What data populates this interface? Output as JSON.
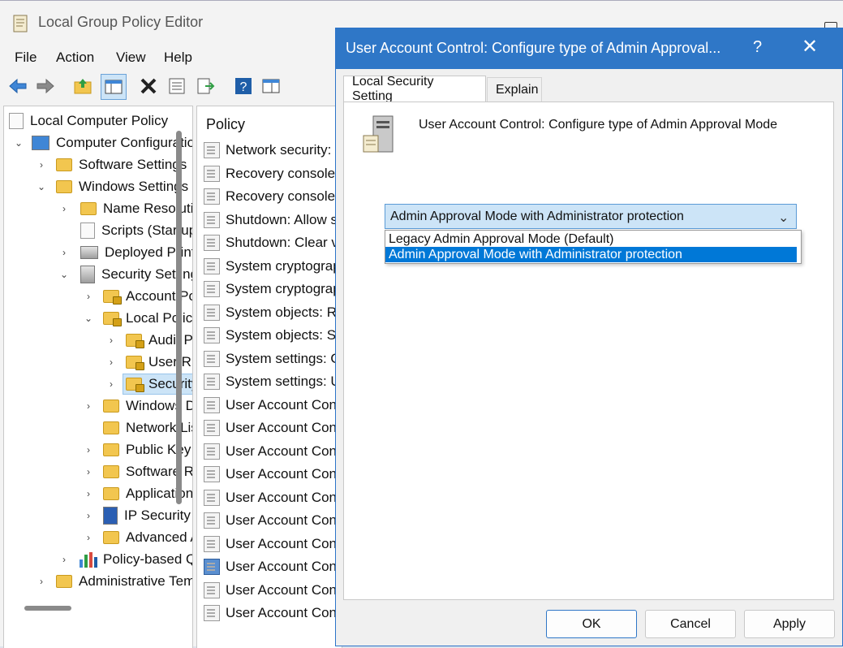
{
  "app": {
    "title": "Local Group Policy Editor"
  },
  "menu": [
    "File",
    "Action",
    "View",
    "Help"
  ],
  "toolbar_icons": [
    "back-arrow-icon",
    "forward-arrow-icon",
    "up-folder-icon",
    "show-hide-tree-icon",
    "delete-icon",
    "properties-icon",
    "export-icon",
    "help-icon",
    "console-icon"
  ],
  "tree": {
    "items": [
      {
        "label": "Local Computer Policy",
        "icon": "policy-scroll-icon"
      },
      {
        "label": "Computer Configuration",
        "icon": "computer-icon"
      },
      {
        "label": "Software Settings",
        "icon": "folder-icon"
      },
      {
        "label": "Windows Settings",
        "icon": "folder-icon"
      },
      {
        "label": "Name Resolution Policy",
        "icon": "folder-icon"
      },
      {
        "label": "Scripts (Startup/Shutdown)",
        "icon": "script-icon"
      },
      {
        "label": "Deployed Printers",
        "icon": "printer-icon"
      },
      {
        "label": "Security Settings",
        "icon": "security-icon"
      },
      {
        "label": "Account Policies",
        "icon": "folder-lock-icon"
      },
      {
        "label": "Local Policies",
        "icon": "folder-lock-icon"
      },
      {
        "label": "Audit Policy",
        "icon": "folder-lock-icon"
      },
      {
        "label": "User Rights Assignment",
        "icon": "folder-lock-icon"
      },
      {
        "label": "Security Options",
        "icon": "folder-lock-icon"
      },
      {
        "label": "Windows Defender Firewall",
        "icon": "folder-icon"
      },
      {
        "label": "Network List Manager Policies",
        "icon": "folder-icon"
      },
      {
        "label": "Public Key Policies",
        "icon": "folder-icon"
      },
      {
        "label": "Software Restriction Policies",
        "icon": "folder-icon"
      },
      {
        "label": "Application Control Policies",
        "icon": "folder-icon"
      },
      {
        "label": "IP Security Policies",
        "icon": "ipsec-icon"
      },
      {
        "label": "Advanced Audit Policy Configuration",
        "icon": "folder-icon"
      },
      {
        "label": "Policy-based QoS",
        "icon": "chart-icon"
      },
      {
        "label": "Administrative Templates",
        "icon": "folder-icon"
      }
    ]
  },
  "policy_pane": {
    "header": "Policy",
    "items": [
      "Network security: Restrict NTLM",
      "Recovery console: Allow automatic administrative logon",
      "Recovery console: Allow floppy copy and access to all drives and folders",
      "Shutdown: Allow system to be shut down without having to log on",
      "Shutdown: Clear virtual memory pagefile",
      "System cryptography: Force strong key protection",
      "System cryptography: Use FIPS compliant algorithms",
      "System objects: Require case insensitivity",
      "System objects: Strengthen default permissions",
      "System settings: Optional subsystems",
      "System settings: Use certificate rules",
      "User Account Control: Admin Approval Mode",
      "User Account Control: Allow UIAccess applications",
      "User Account Control: Behavior of the elevation prompt for administrators",
      "User Account Control: Behavior of the elevation prompt for standard users",
      "User Account Control: Detect application installations",
      "User Account Control: Only elevate executables",
      "User Account Control: Only elevate UIAccess applications",
      "User Account Control: Configure type of Admin Approval Mode",
      "User Account Control: Run all administrators",
      "User Account Control: Switch to the secure desktop"
    ],
    "selected_index": 18
  },
  "dialog": {
    "title": "User Account Control: Configure type of Admin Approval...",
    "help": "?",
    "close": "✕",
    "tabs": [
      "Local Security Setting",
      "Explain"
    ],
    "setting_title": "User Account Control: Configure type of Admin Approval Mode",
    "combo_value": "Admin Approval Mode with Administrator protection",
    "options": [
      "Legacy Admin Approval Mode (Default)",
      "Admin Approval Mode with Administrator protection"
    ],
    "buttons": {
      "ok": "OK",
      "cancel": "Cancel",
      "apply": "Apply"
    },
    "accent": "#2f77c7"
  }
}
